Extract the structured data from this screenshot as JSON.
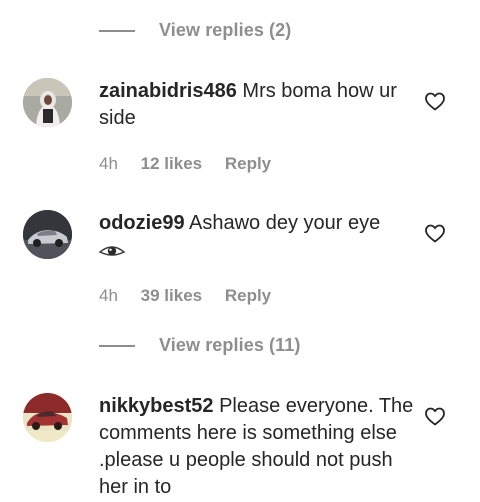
{
  "top_replies": {
    "label": "View replies (2)"
  },
  "comments": [
    {
      "username": "zainabidris486",
      "text": "Mrs boma how ur side",
      "time": "4h",
      "likes": "12 likes",
      "reply_label": "Reply"
    },
    {
      "username": "odozie99",
      "text": "Ashawo dey your eye",
      "emoji": "eye-icon",
      "time": "4h",
      "likes": "39 likes",
      "reply_label": "Reply",
      "replies_label": "View replies (11)"
    },
    {
      "username": "nikkybest52",
      "text": "Please everyone. The comments here is something else .please u people should not push her in to"
    }
  ],
  "colors": {
    "text": "#262626",
    "muted": "#8e8e8e",
    "background": "#ffffff"
  }
}
